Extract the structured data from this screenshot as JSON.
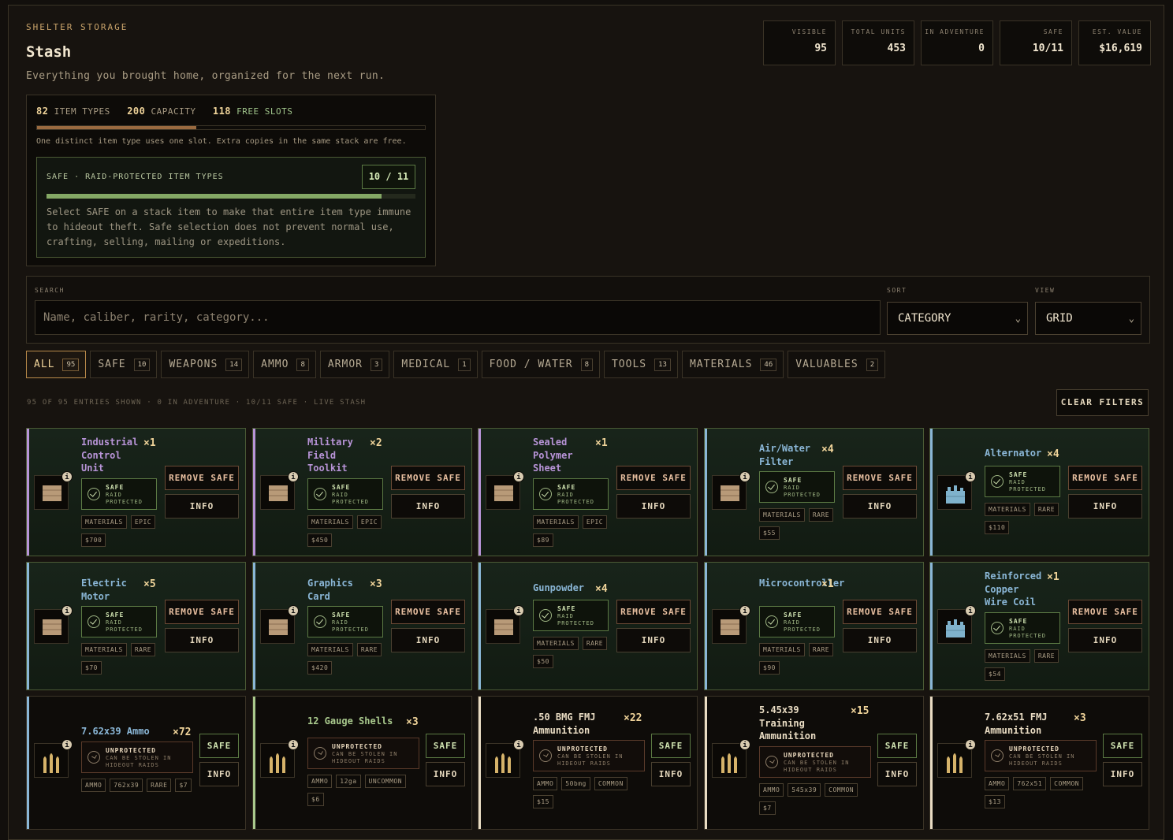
{
  "header": {
    "eyebrow": "SHELTER STORAGE",
    "title": "Stash",
    "subtitle": "Everything you brought home, organized for the next run."
  },
  "stats": [
    {
      "label": "VISIBLE",
      "value": "95"
    },
    {
      "label": "TOTAL UNITS",
      "value": "453"
    },
    {
      "label": "IN ADVENTURE",
      "value": "0"
    },
    {
      "label": "SAFE",
      "value": "10/11"
    },
    {
      "label": "EST. VALUE",
      "value": "$16,619"
    }
  ],
  "capacity": {
    "item_types": "82",
    "item_types_label": "ITEM TYPES",
    "capacity": "200",
    "capacity_label": "CAPACITY",
    "free": "118",
    "free_label": "FREE SLOTS",
    "fill_fraction": 0.41,
    "note": "One distinct item type uses one slot. Extra copies in the same stack are free."
  },
  "safe_panel": {
    "heading": "SAFE · RAID-PROTECTED ITEM TYPES",
    "count": "10 / 11",
    "fill_fraction": 0.909,
    "text": "Select SAFE on a stack item to make that entire item type immune to hideout theft. Safe selection does not prevent normal use, crafting, selling, mailing or expeditions."
  },
  "search": {
    "label": "SEARCH",
    "placeholder": "Name, caliber, rarity, category...",
    "sort_label": "SORT",
    "sort_value": "CATEGORY",
    "view_label": "VIEW",
    "view_value": "GRID"
  },
  "tabs": [
    {
      "label": "ALL",
      "count": "95"
    },
    {
      "label": "SAFE",
      "count": "10"
    },
    {
      "label": "WEAPONS",
      "count": "14"
    },
    {
      "label": "AMMO",
      "count": "8"
    },
    {
      "label": "ARMOR",
      "count": "3"
    },
    {
      "label": "MEDICAL",
      "count": "1"
    },
    {
      "label": "FOOD / WATER",
      "count": "8"
    },
    {
      "label": "TOOLS",
      "count": "13"
    },
    {
      "label": "MATERIALS",
      "count": "46"
    },
    {
      "label": "VALUABLES",
      "count": "2"
    }
  ],
  "summary": "95 OF 95 ENTRIES SHOWN · 0 IN ADVENTURE · 10/11 SAFE · LIVE STASH",
  "clear_label": "CLEAR FILTERS",
  "labels": {
    "remove_safe": "REMOVE SAFE",
    "safe": "SAFE",
    "info": "INFO",
    "safe_badge": "SAFE",
    "safe_badge_sub": "RAID PROTECTED",
    "unprotected": "UNPROTECTED",
    "unprotected_sub": "CAN BE STOLEN IN HIDEOUT RAIDS"
  },
  "colors": {
    "epic": "#b894d8",
    "rare": "#8ab6d6",
    "uncommon": "#a9c98d",
    "common": "#e9dcc3"
  },
  "items": [
    {
      "name": "Industrial Control Unit",
      "qty": "×1",
      "safe": true,
      "tags": [
        "MATERIALS",
        "EPIC",
        "$700"
      ],
      "rarity": "epic",
      "icon": "crate-icon"
    },
    {
      "name": "Military Field Toolkit",
      "qty": "×2",
      "safe": true,
      "tags": [
        "MATERIALS",
        "EPIC",
        "$450"
      ],
      "rarity": "epic",
      "icon": "crate-icon"
    },
    {
      "name": "Sealed Polymer Sheet",
      "qty": "×1",
      "safe": true,
      "tags": [
        "MATERIALS",
        "EPIC",
        "$89"
      ],
      "rarity": "epic",
      "icon": "crate-icon"
    },
    {
      "name": "Air/Water Filter",
      "qty": "×4",
      "safe": true,
      "tags": [
        "MATERIALS",
        "RARE",
        "$55"
      ],
      "rarity": "rare",
      "icon": "crate-icon"
    },
    {
      "name": "Alternator",
      "qty": "×4",
      "safe": true,
      "tags": [
        "MATERIALS",
        "RARE",
        "$110"
      ],
      "rarity": "rare",
      "icon": "machine-icon"
    },
    {
      "name": "Electric Motor",
      "qty": "×5",
      "safe": true,
      "tags": [
        "MATERIALS",
        "RARE",
        "$70"
      ],
      "rarity": "rare",
      "icon": "crate-icon"
    },
    {
      "name": "Graphics Card",
      "qty": "×3",
      "safe": true,
      "tags": [
        "MATERIALS",
        "RARE",
        "$420"
      ],
      "rarity": "rare",
      "icon": "crate-icon"
    },
    {
      "name": "Gunpowder",
      "qty": "×4",
      "safe": true,
      "tags": [
        "MATERIALS",
        "RARE",
        "$50"
      ],
      "rarity": "rare",
      "icon": "crate-icon"
    },
    {
      "name": "Microcontroller",
      "qty": "×1",
      "safe": true,
      "tags": [
        "MATERIALS",
        "RARE",
        "$90"
      ],
      "rarity": "rare",
      "icon": "crate-icon"
    },
    {
      "name": "Reinforced Copper Wire Coil",
      "qty": "×1",
      "safe": true,
      "tags": [
        "MATERIALS",
        "RARE",
        "$54"
      ],
      "rarity": "rare",
      "icon": "machine-icon"
    },
    {
      "name": "7.62x39 Ammo",
      "qty": "×72",
      "safe": false,
      "tags": [
        "AMMO",
        "762x39",
        "RARE",
        "$7"
      ],
      "rarity": "rare",
      "icon": "ammo-icon"
    },
    {
      "name": "12 Gauge Shells",
      "qty": "×3",
      "safe": false,
      "tags": [
        "AMMO",
        "12ga",
        "UNCOMMON",
        "$6"
      ],
      "rarity": "uncommon",
      "icon": "ammo-icon"
    },
    {
      "name": ".50 BMG FMJ Ammunition",
      "qty": "×22",
      "safe": false,
      "tags": [
        "AMMO",
        "50bmg",
        "COMMON",
        "$15"
      ],
      "rarity": "common",
      "icon": "ammo-icon"
    },
    {
      "name": "5.45x39 Training Ammunition",
      "qty": "×15",
      "safe": false,
      "tags": [
        "AMMO",
        "545x39",
        "COMMON",
        "$7"
      ],
      "rarity": "common",
      "icon": "ammo-icon"
    },
    {
      "name": "7.62x51 FMJ Ammunition",
      "qty": "×3",
      "safe": false,
      "tags": [
        "AMMO",
        "762x51",
        "COMMON",
        "$13"
      ],
      "rarity": "common",
      "icon": "ammo-icon"
    }
  ]
}
